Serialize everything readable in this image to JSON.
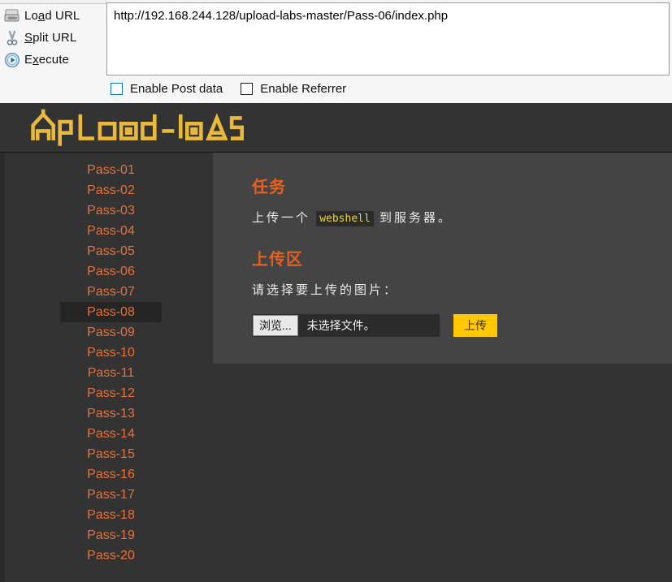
{
  "hackbar": {
    "actions": [
      {
        "icon": "load-url-icon",
        "label_pre": "Lo",
        "label_acc": "a",
        "label_post": "d URL",
        "name": "load-url"
      },
      {
        "icon": "scissors-icon",
        "label_pre": "",
        "label_acc": "S",
        "label_post": "plit URL",
        "name": "split-url"
      },
      {
        "icon": "execute-play-icon",
        "label_pre": "E",
        "label_acc": "x",
        "label_post": "ecute",
        "name": "execute"
      }
    ],
    "url_value": "http://192.168.244.128/upload-labs-master/Pass-06/index.php",
    "url_placeholder": "",
    "checkboxes": [
      {
        "label": "Enable Post data",
        "checked": false,
        "focused": true
      },
      {
        "label": "Enable Referrer",
        "checked": false,
        "focused": false
      }
    ]
  },
  "site": {
    "logo_text": "upLoad-labs",
    "nav": [
      {
        "label": "Pass-01",
        "active": false
      },
      {
        "label": "Pass-02",
        "active": false
      },
      {
        "label": "Pass-03",
        "active": false
      },
      {
        "label": "Pass-04",
        "active": false
      },
      {
        "label": "Pass-05",
        "active": false
      },
      {
        "label": "Pass-06",
        "active": false
      },
      {
        "label": "Pass-07",
        "active": false
      },
      {
        "label": "Pass-08",
        "active": true
      },
      {
        "label": "Pass-09",
        "active": false
      },
      {
        "label": "Pass-10",
        "active": false
      },
      {
        "label": "Pass-11",
        "active": false
      },
      {
        "label": "Pass-12",
        "active": false
      },
      {
        "label": "Pass-13",
        "active": false
      },
      {
        "label": "Pass-14",
        "active": false
      },
      {
        "label": "Pass-15",
        "active": false
      },
      {
        "label": "Pass-16",
        "active": false
      },
      {
        "label": "Pass-17",
        "active": false
      },
      {
        "label": "Pass-18",
        "active": false
      },
      {
        "label": "Pass-19",
        "active": false
      },
      {
        "label": "Pass-20",
        "active": false
      }
    ],
    "task": {
      "heading": "任务",
      "text_before": "上传一个",
      "code": "webshell",
      "text_after": "到服务器。"
    },
    "upload": {
      "heading": "上传区",
      "prompt": "请选择要上传的图片：",
      "browse_label": "浏览...",
      "file_status": "未选择文件。",
      "submit_label": "上传"
    }
  },
  "colors": {
    "accent_orange": "#e8601c",
    "nav_orange": "#e8703a",
    "logo_gold": "#e8b93c",
    "submit_yellow": "#ffc800",
    "code_yellow": "#e8d44d",
    "page_bg": "#333333",
    "card_bg": "#444444"
  }
}
